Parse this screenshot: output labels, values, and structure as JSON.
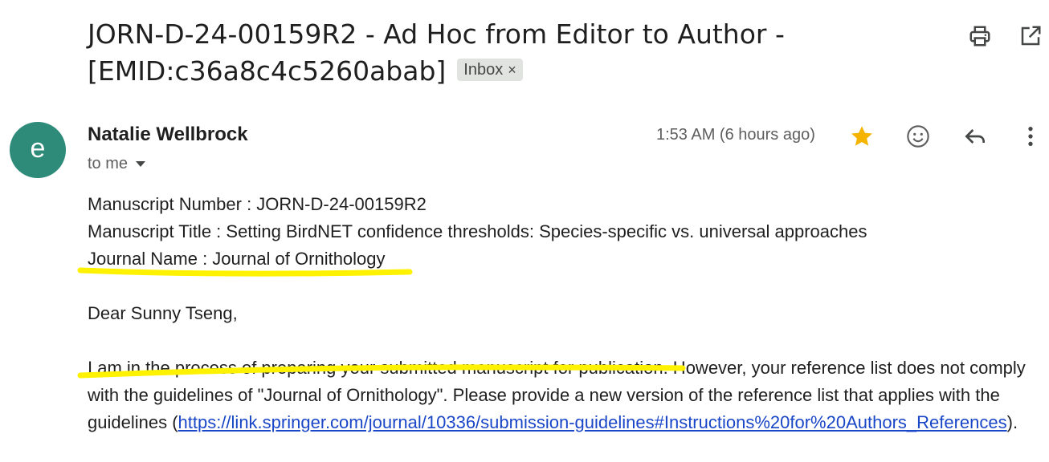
{
  "subject": {
    "line1": "JORN-D-24-00159R2 - Ad Hoc from Editor to Author -",
    "line2": "[EMID:c36a8c4c5260abab]",
    "label_chip": "Inbox",
    "label_chip_close": "×"
  },
  "toolbar": {
    "print_icon": "print-icon",
    "open_new_window_icon": "open-in-new-window-icon"
  },
  "message": {
    "avatar_letter": "e",
    "avatar_color": "#2e8b7a",
    "sender_name": "Natalie Wellbrock",
    "recipient": "to me",
    "timestamp": "1:53 AM (6 hours ago)",
    "star_color": "#f4b400",
    "actions": [
      "star-icon",
      "emoji-reaction-icon",
      "reply-icon",
      "more-options-icon"
    ]
  },
  "body": {
    "manuscript_number": "Manuscript Number : JORN-D-24-00159R2",
    "manuscript_title": "Manuscript Title : Setting BirdNET confidence thresholds: Species-specific vs. universal approaches",
    "journal_name": "Journal Name : Journal of Ornithology",
    "greeting": "Dear Sunny Tseng,",
    "paragraph_before_link": "I am in the process of preparing your submitted manuscript for publication. However, your reference list does not comply with the guidelines of \"Journal of Ornithology\". Please provide a new version of the reference list that applies with the guidelines (",
    "link_text": "https://link.springer.com/journal/10336/submission-guidelines#Instructions%20for%20Authors_References",
    "paragraph_after_link": ")."
  },
  "annotation": {
    "highlighter_color": "#fff200"
  }
}
